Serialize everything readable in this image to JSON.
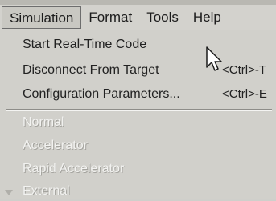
{
  "menubar": {
    "menus": [
      "Simulation",
      "Format",
      "Tools",
      "Help"
    ]
  },
  "dropdown": {
    "items": [
      {
        "label": "Start Real-Time Code",
        "accelerator": ""
      },
      {
        "label": "Disconnect From Target",
        "accelerator": "<Ctrl>-T"
      },
      {
        "label": "Configuration Parameters...",
        "accelerator": "<Ctrl>-E"
      },
      {
        "label": "Normal",
        "accelerator": ""
      },
      {
        "label": "Accelerator",
        "accelerator": ""
      },
      {
        "label": "Rapid Accelerator",
        "accelerator": ""
      },
      {
        "label": "External",
        "accelerator": ""
      }
    ]
  },
  "icons": {
    "pointer": "mouse-pointer-icon",
    "radio": "radio-indicator-icon"
  },
  "colors": {
    "background": "#d1d0cb",
    "text": "#222222",
    "disabled_text": "#f2f2f0"
  }
}
